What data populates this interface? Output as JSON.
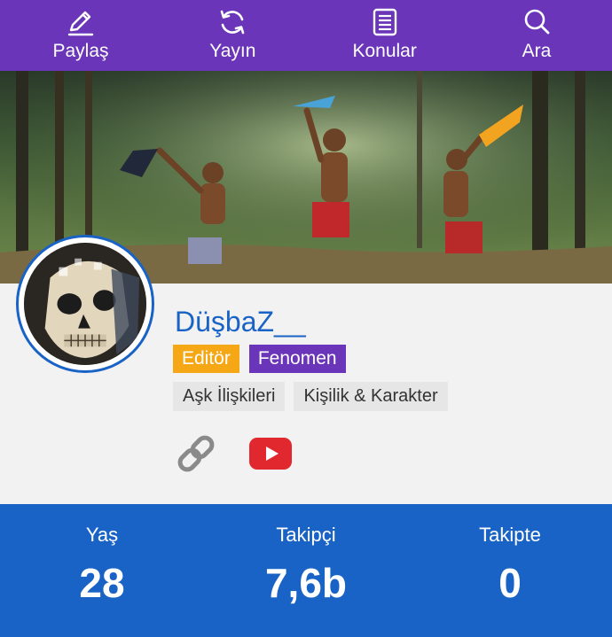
{
  "nav": {
    "items": [
      {
        "label": "Paylaş",
        "icon": "pencil-icon"
      },
      {
        "label": "Yayın",
        "icon": "refresh-icon"
      },
      {
        "label": "Konular",
        "icon": "document-list-icon"
      },
      {
        "label": "Ara",
        "icon": "search-icon"
      }
    ]
  },
  "profile": {
    "username": "DüşbaZ__",
    "badges": [
      {
        "label": "Editör",
        "color": "#f6a716"
      },
      {
        "label": "Fenomen",
        "color": "#6a35b8"
      }
    ],
    "topics": [
      "Aşk İlişkileri",
      "Kişilik & Karakter"
    ],
    "social": [
      "link-icon",
      "youtube-icon"
    ]
  },
  "stats": [
    {
      "label": "Yaş",
      "value": "28"
    },
    {
      "label": "Takipçi",
      "value": "7,6b"
    },
    {
      "label": "Takipte",
      "value": "0"
    }
  ],
  "colors": {
    "nav_bg": "#6a35b8",
    "accent_blue": "#1a63c6",
    "youtube_red": "#e1282e"
  }
}
